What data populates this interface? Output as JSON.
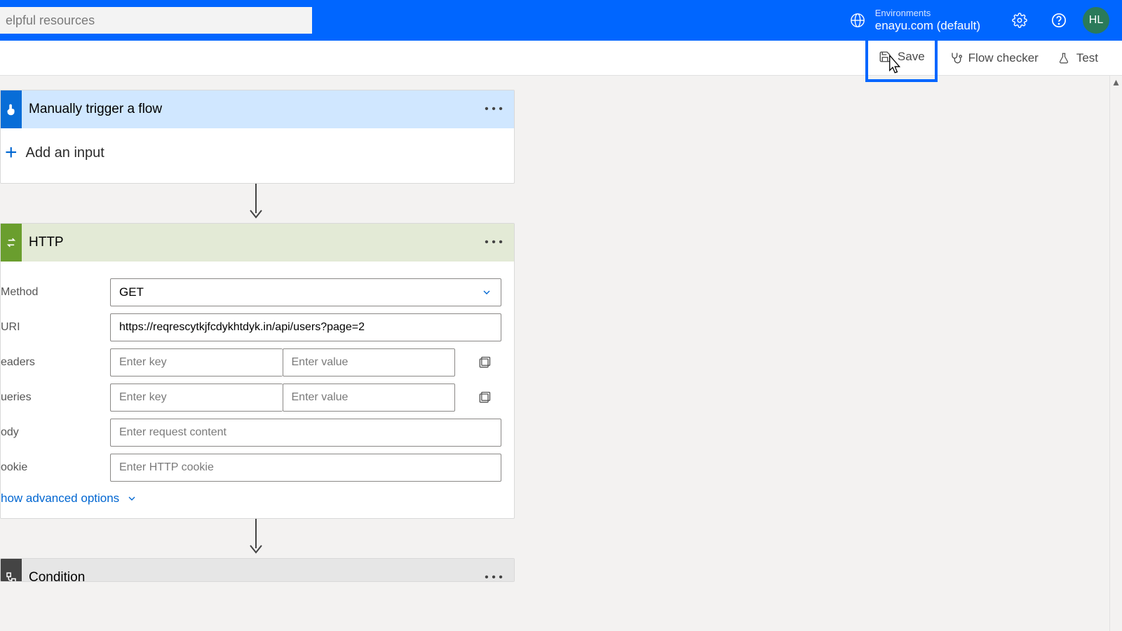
{
  "header": {
    "search_placeholder": "elpful resources",
    "env_label": "Environments",
    "env_name": "enayu.com (default)",
    "avatar": "HL"
  },
  "toolbar": {
    "save": "Save",
    "flow_checker": "Flow checker",
    "test": "Test"
  },
  "trigger": {
    "title": "Manually trigger a flow",
    "add_input": "Add an input"
  },
  "http": {
    "title": "HTTP",
    "labels": {
      "method": "Method",
      "uri": "URI",
      "headers": "eaders",
      "queries": "ueries",
      "body": "ody",
      "cookie": "ookie"
    },
    "method_value": "GET",
    "uri_value": "https://reqrescytkjfcdykhtdyk.in/api/users?page=2",
    "key_placeholder": "Enter key",
    "value_placeholder": "Enter value",
    "body_placeholder": "Enter request content",
    "cookie_placeholder": "Enter HTTP cookie",
    "advanced": "how advanced options"
  },
  "condition": {
    "title": "Condition"
  }
}
